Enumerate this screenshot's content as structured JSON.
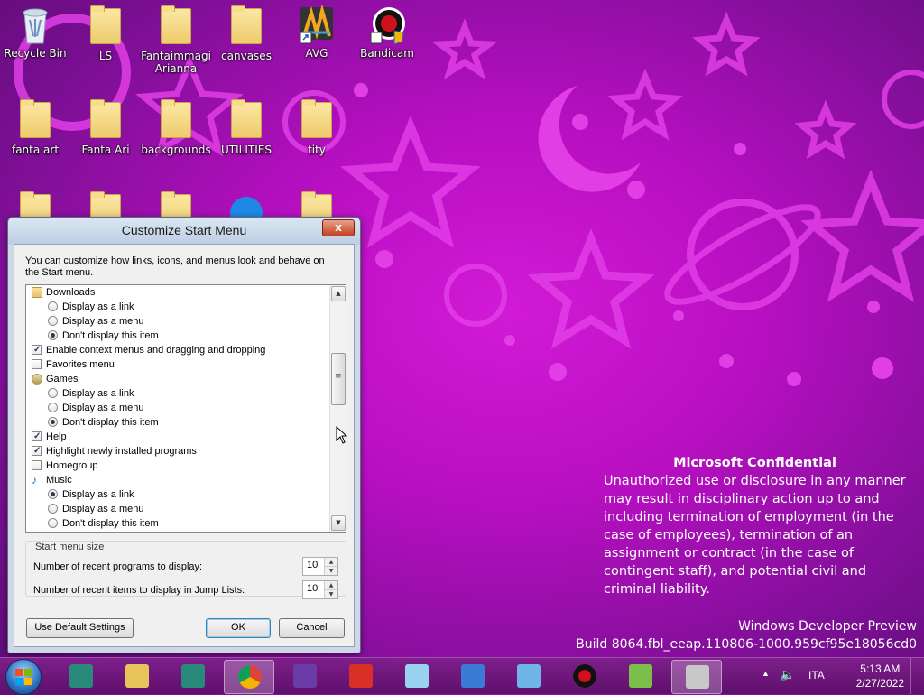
{
  "desktop": {
    "icons": [
      {
        "label": "Recycle Bin",
        "icon": "recycle-bin-icon"
      },
      {
        "label": "LS",
        "icon": "folder-icon"
      },
      {
        "label": "Fantaimmagi Arianna",
        "icon": "folder-icon"
      },
      {
        "label": "canvases",
        "icon": "folder-icon"
      },
      {
        "label": "AVG",
        "icon": "avg-icon"
      },
      {
        "label": "Bandicam",
        "icon": "bandicam-icon"
      },
      {
        "label": "fanta art",
        "icon": "folder-icon"
      },
      {
        "label": "Fanta Ari",
        "icon": "folder-icon"
      },
      {
        "label": "backgrounds",
        "icon": "folder-icon"
      },
      {
        "label": "UTILITIES",
        "icon": "folder-icon"
      },
      {
        "label": "tity",
        "icon": "folder-icon"
      }
    ],
    "confidential": {
      "title": "Microsoft Confidential",
      "text": "Unauthorized use or disclosure in any manner may result in disciplinary action up to and including termination of employment (in the case of employees), termination of an assignment or contract (in the case of contingent staff), and potential civil and criminal liability."
    },
    "build": {
      "line1": "Windows Developer Preview",
      "line2": "Build 8064.fbl_eeap.110806-1000.959cf95e18056cd0"
    }
  },
  "dialog": {
    "title": "Customize Start Menu",
    "close_label": "x",
    "description": "You can customize how links, icons, and menus look and behave on the Start menu.",
    "items": [
      {
        "type": "header",
        "icon": "downloads-folder-icon",
        "label": "Downloads"
      },
      {
        "type": "radio",
        "checked": false,
        "label": "Display as a link"
      },
      {
        "type": "radio",
        "checked": false,
        "label": "Display as a menu"
      },
      {
        "type": "radio",
        "checked": true,
        "label": "Don't display this item"
      },
      {
        "type": "check",
        "checked": true,
        "label": "Enable context menus and dragging and dropping"
      },
      {
        "type": "check",
        "checked": false,
        "label": "Favorites menu"
      },
      {
        "type": "header",
        "icon": "games-icon",
        "label": "Games"
      },
      {
        "type": "radio",
        "checked": false,
        "label": "Display as a link"
      },
      {
        "type": "radio",
        "checked": false,
        "label": "Display as a menu"
      },
      {
        "type": "radio",
        "checked": true,
        "label": "Don't display this item"
      },
      {
        "type": "check",
        "checked": true,
        "label": "Help"
      },
      {
        "type": "check",
        "checked": true,
        "label": "Highlight newly installed programs"
      },
      {
        "type": "check",
        "checked": false,
        "label": "Homegroup"
      },
      {
        "type": "header",
        "icon": "music-icon",
        "label": "Music"
      },
      {
        "type": "radio",
        "checked": true,
        "label": "Display as a link"
      },
      {
        "type": "radio",
        "checked": false,
        "label": "Display as a menu"
      },
      {
        "type": "radio",
        "checked": false,
        "label": "Don't display this item"
      }
    ],
    "size_group": {
      "legend": "Start menu size",
      "recent_programs_label": "Number of recent programs to display:",
      "recent_programs_value": "10",
      "jump_list_label": "Number of recent items to display in Jump Lists:",
      "jump_list_value": "10"
    },
    "buttons": {
      "defaults": "Use Default Settings",
      "ok": "OK",
      "cancel": "Cancel"
    }
  },
  "taskbar": {
    "apps": [
      {
        "name": "credit-agricole-icon",
        "color": "#2a8a7a"
      },
      {
        "name": "file-explorer-icon",
        "color": "#e8c35a"
      },
      {
        "name": "credit-agricole-icon",
        "color": "#2a8a7a"
      },
      {
        "name": "chrome-icon",
        "color": "#dd4b39",
        "active": true
      },
      {
        "name": "wr-icon",
        "color": "#6b3ca8"
      },
      {
        "name": "gmail-icon",
        "color": "#d93025"
      },
      {
        "name": "sticky-notes-icon",
        "color": "#9ad3f0"
      },
      {
        "name": "translator-icon",
        "color": "#3a7bd5"
      },
      {
        "name": "paint-icon",
        "color": "#6fb5e8"
      },
      {
        "name": "bandicam-icon",
        "color": "#c0121b"
      },
      {
        "name": "maps-icon",
        "color": "#7bbf4a"
      },
      {
        "name": "control-panel-icon",
        "color": "#c8c8c8",
        "active": true
      }
    ],
    "tray": {
      "language": "ITA",
      "time": "5:13 AM",
      "date": "2/27/2022"
    }
  }
}
